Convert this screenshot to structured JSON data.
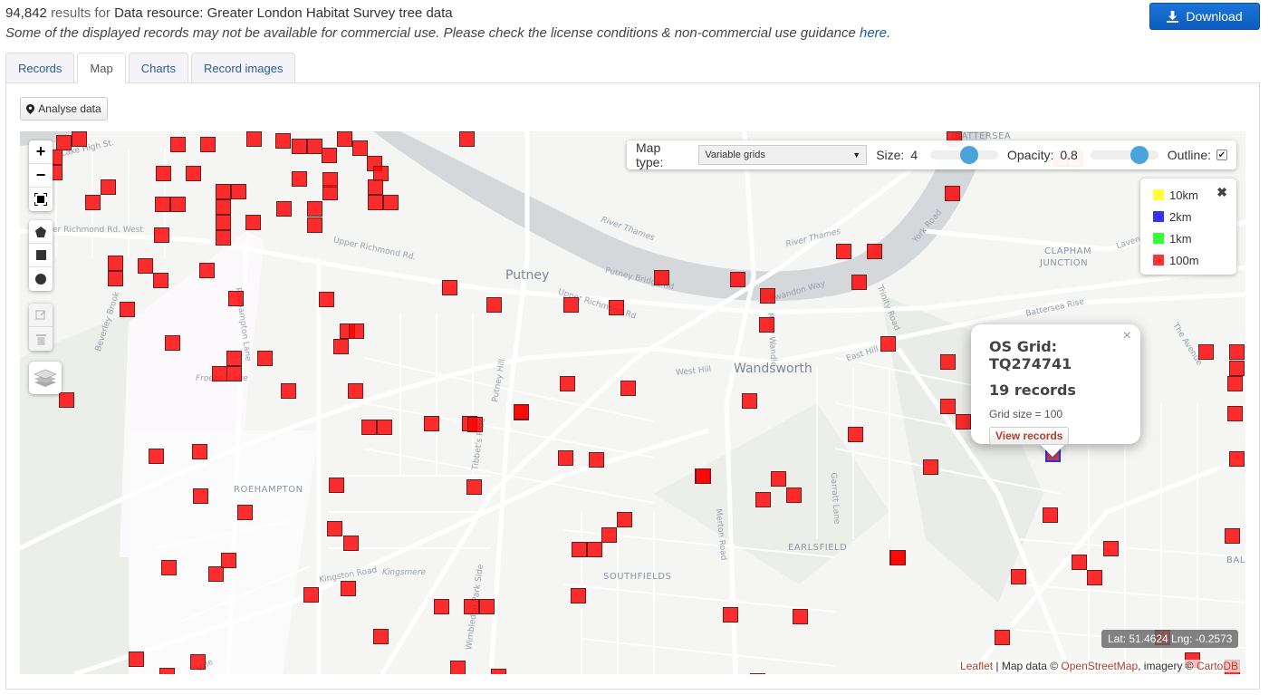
{
  "header": {
    "count": "94,842",
    "results_for": "results for",
    "resource": "Data resource: Greater London Habitat Survey tree data",
    "notice": "Some of the displayed records may not be available for commercial use. Please check the license conditions & non-commercial use guidance ",
    "notice_link": "here",
    "notice_end": "."
  },
  "download": {
    "label": "Download",
    "icon": "download-icon"
  },
  "tabs": [
    {
      "label": "Records",
      "active": false
    },
    {
      "label": "Map",
      "active": true
    },
    {
      "label": "Charts",
      "active": false
    },
    {
      "label": "Record images",
      "active": false
    }
  ],
  "analyse_button": {
    "label": "Analyse data",
    "icon": "map-marker-icon"
  },
  "map_controls": {
    "map_type_label": "Map type:",
    "map_type_value": "Variable grids",
    "size_label": "Size:",
    "size_value": "4",
    "size_slider_fraction": 0.6,
    "opacity_label": "Opacity:",
    "opacity_value": "0.8",
    "opacity_slider_fraction": 0.8,
    "outline_label": "Outline:",
    "outline_checked": true
  },
  "legend": {
    "items": [
      {
        "label": "10km",
        "color": "#ffff33"
      },
      {
        "label": "2km",
        "color": "#3333ff"
      },
      {
        "label": "1km",
        "color": "#33ff33"
      },
      {
        "label": "100m",
        "color": "#ff3333"
      }
    ],
    "close_icon": "close-icon"
  },
  "popup": {
    "title": "OS Grid: TQ274741",
    "records": "19 records",
    "grid_size": "Grid size = 100",
    "button": "View records"
  },
  "coordinates": "Lat: 51.4624 Lng: -0.2573",
  "attribution": {
    "leaflet": "Leaflet",
    "sep1": " | Map data © ",
    "osm": "OpenStreetMap",
    "sep2": ", imagery © ",
    "carto": "CartoDB"
  },
  "map_labels": {
    "towns": [
      "Putney",
      "Wandsworth"
    ],
    "districts": [
      "BATTERSEA",
      "CLAPHAM",
      "JUNCTION",
      "ROEHAMPTON",
      "SOUTHFIELDS",
      "EARLSFIELD",
      "BALHAM"
    ],
    "roads": [
      "Lake High St.",
      "Upper Richmond Rd. West",
      "Upper Richmond Rd.",
      "Upper Richmond Rd",
      "Putney Bridge Rd",
      "Putney Hill",
      "Roehampton Lane",
      "Beverley Brook",
      "West Hill",
      "East Hill",
      "Swandon Way",
      "Trinity Road",
      "York Road",
      "Battersea Rise",
      "Lavender",
      "The Avenue",
      "Merton Road",
      "Garratt Lane",
      "Wimbledon Park Side",
      "Tibbet's Ride",
      "Kingston Road",
      "Kingsmere",
      "Vale",
      "Froebel Lake",
      "River Wandle"
    ],
    "water": [
      "River Thames",
      "River Thames"
    ]
  },
  "map_tool_buttons": [
    "zoom-in",
    "zoom-out",
    "fullscreen",
    "draw-polygon",
    "draw-rectangle",
    "draw-circle",
    "edit",
    "delete",
    "layers"
  ]
}
